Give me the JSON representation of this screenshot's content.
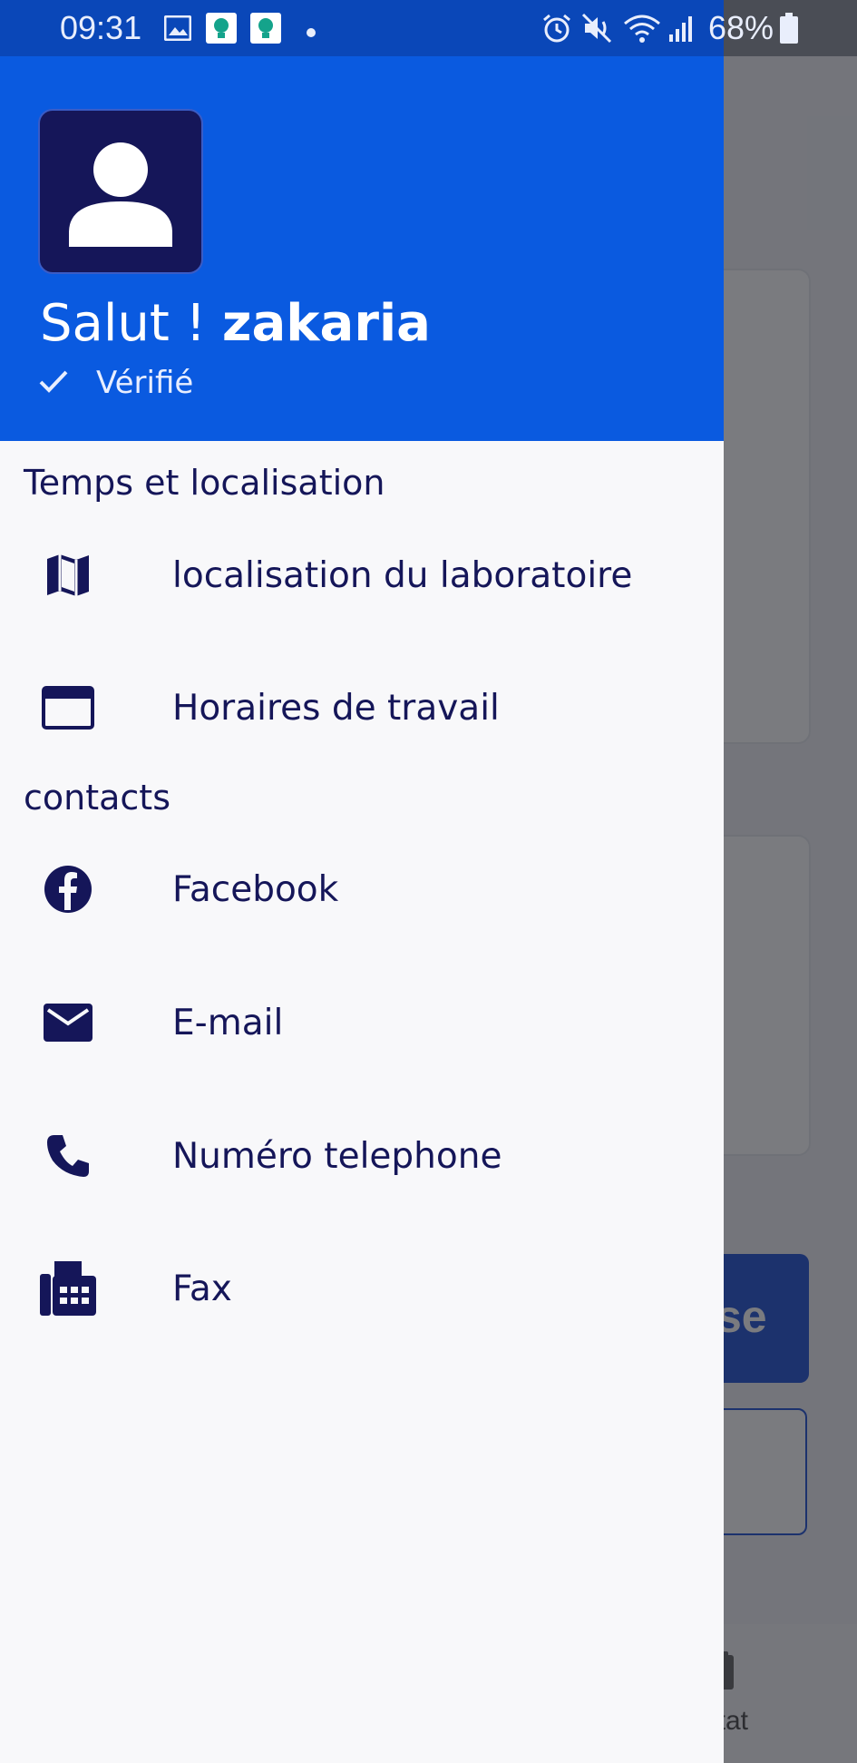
{
  "status_bar": {
    "time": "09:31",
    "battery": "68%",
    "icons": [
      "gallery-icon",
      "app-notification-icon",
      "app-notification-icon",
      "dot-icon",
      "alarm-icon",
      "mute-icon",
      "wifi-icon",
      "signal-icon",
      "battery-icon"
    ]
  },
  "drawer": {
    "greeting_prefix": "Salut ! ",
    "username": "zakaria",
    "verified_label": "Vérifié",
    "sections": [
      {
        "title": "Temps et localisation",
        "items": [
          {
            "label": "localisation du laboratoire",
            "icon": "map-icon"
          },
          {
            "label": "Horaires de travail",
            "icon": "window-icon"
          }
        ]
      },
      {
        "title": "contacts",
        "items": [
          {
            "label": "Facebook",
            "icon": "facebook-icon"
          },
          {
            "label": "E-mail",
            "icon": "mail-icon"
          },
          {
            "label": "Numéro telephone",
            "icon": "phone-icon"
          },
          {
            "label": "Fax",
            "icon": "fax-icon"
          }
        ]
      }
    ]
  },
  "background": {
    "button_fragment": "se",
    "tab_fragment": "ltat"
  },
  "colors": {
    "header_blue": "#0a5ae0",
    "navy": "#151659",
    "drawer_bg": "#f8f8fa"
  }
}
